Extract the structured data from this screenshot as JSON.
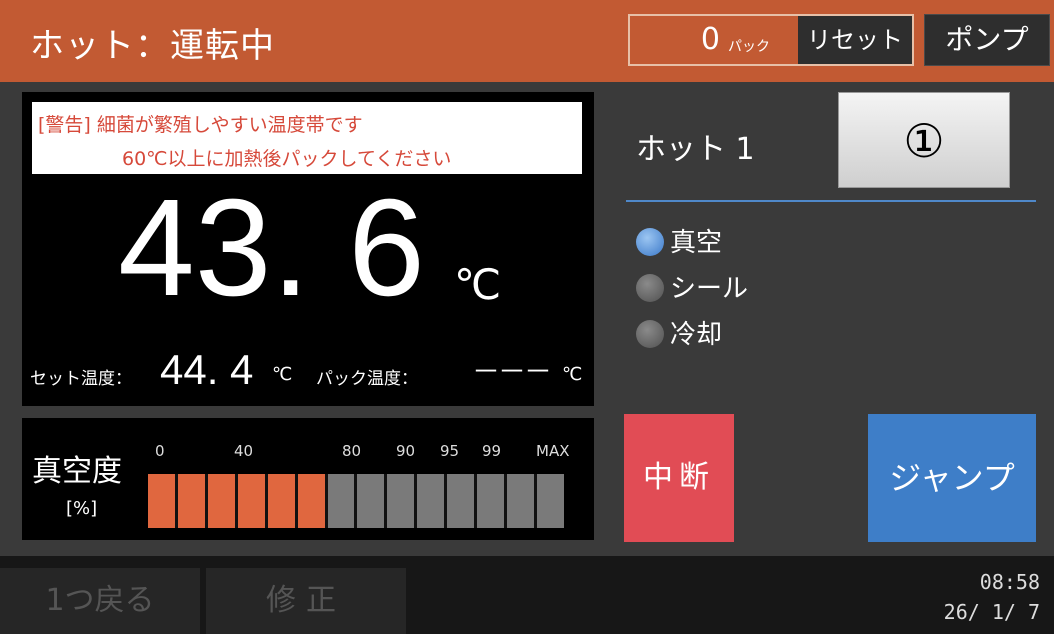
{
  "header": {
    "title": "ホット：運転中",
    "pack_count": "0",
    "pack_unit": "パック",
    "reset_label": "リセット",
    "pump_label": "ポンプ"
  },
  "temperature": {
    "warning_line1": "[警告] 細菌が繁殖しやすい温度帯です",
    "warning_line2": "60℃以上に加熱後パックしてください",
    "current_value": "43. 6",
    "unit": "℃",
    "set_label": "セット温度：",
    "set_value": "44. 4",
    "set_unit": "℃",
    "pack_label": "パック温度：",
    "pack_value": "－－－",
    "pack_unit": "℃"
  },
  "vacuum": {
    "label": "真空度",
    "unit": "[%]",
    "ticks": [
      "0",
      "40",
      "80",
      "90",
      "95",
      "99",
      "MAX"
    ],
    "segments_total": 14,
    "segments_filled": 6
  },
  "program": {
    "label": "ホット 1",
    "number_button": "①"
  },
  "steps": [
    {
      "label": "真空",
      "active": true
    },
    {
      "label": "シール",
      "active": false
    },
    {
      "label": "冷却",
      "active": false
    }
  ],
  "actions": {
    "stop": "中断",
    "jump": "ジャンプ"
  },
  "footer": {
    "back": "1つ戻る",
    "edit": "修正",
    "time": "08:58",
    "date": "26/ 1/ 7"
  },
  "colors": {
    "header_bg": "#c25a33",
    "bar_on": "#e0673f",
    "bar_off": "#7a7a7a",
    "stop_bg": "#e14c55",
    "jump_bg": "#3e7ec8",
    "divider": "#4f88c9"
  }
}
